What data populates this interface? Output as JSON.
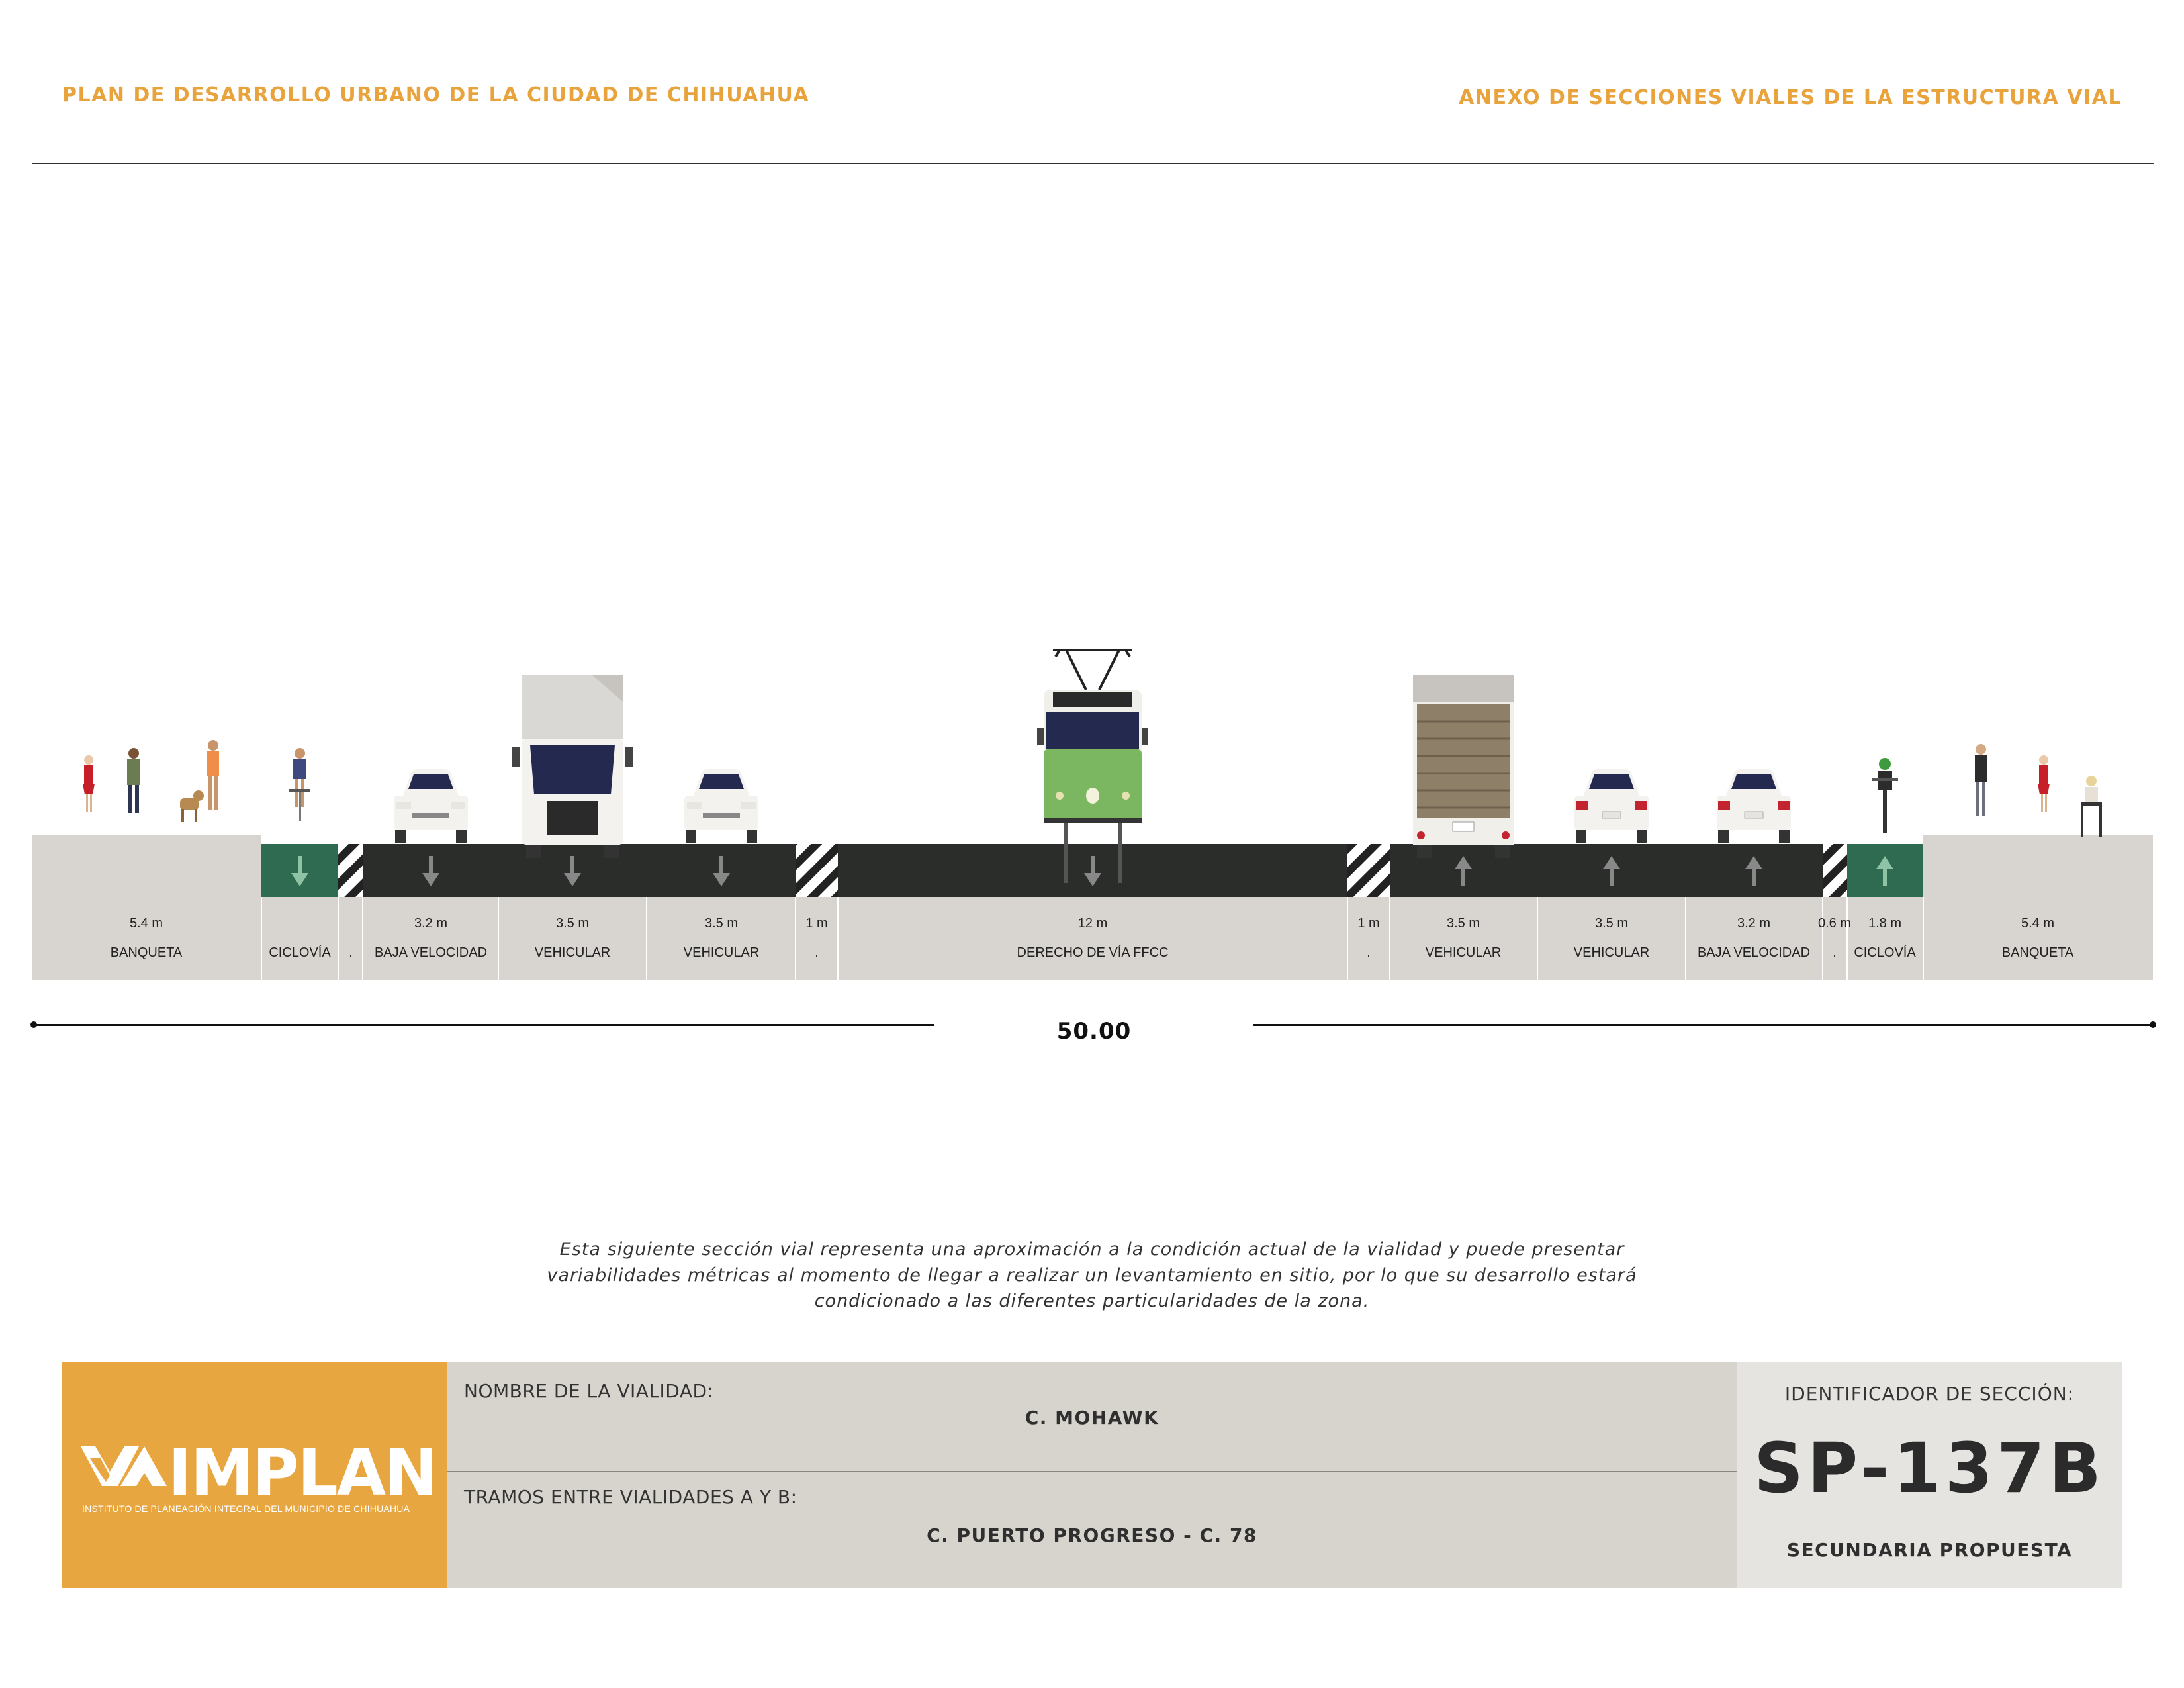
{
  "header": {
    "left_title": "PLAN DE DESARROLLO URBANO DE LA CIUDAD DE CHIHUAHUA",
    "right_title": "ANEXO DE SECCIONES VIALES DE LA ESTRUCTURA VIAL"
  },
  "colors": {
    "accent": "#E8A33D",
    "road": "#2B2D2B",
    "bikeway": "#2E6B50",
    "sidewalk": "#D8D4CF",
    "tram": "#7BB661"
  },
  "lanes": [
    {
      "width": "5.4 m",
      "label": "BANQUETA"
    },
    {
      "width": "",
      "label": "CICLOVÍA"
    },
    {
      "width": "",
      "label": "."
    },
    {
      "width": "3.2 m",
      "label": "BAJA VELOCIDAD"
    },
    {
      "width": "3.5 m",
      "label": "VEHICULAR"
    },
    {
      "width": "3.5 m",
      "label": "VEHICULAR"
    },
    {
      "width": "1 m",
      "label": "."
    },
    {
      "width": "12 m",
      "label": "DERECHO DE VÍA FFCC"
    },
    {
      "width": "1 m",
      "label": "."
    },
    {
      "width": "3.5 m",
      "label": "VEHICULAR"
    },
    {
      "width": "3.5 m",
      "label": "VEHICULAR"
    },
    {
      "width": "3.2 m",
      "label": "BAJA VELOCIDAD"
    },
    {
      "width": "0.6 m",
      "label": "."
    },
    {
      "width": "1.8 m",
      "label": "CICLOVÍA"
    },
    {
      "width": "5.4 m",
      "label": "BANQUETA"
    }
  ],
  "total_width": "50.00",
  "disclaimer": "Esta siguiente sección vial representa una aproximación a la condición actual de la vialidad y puede presentar variabilidades métricas al momento de llegar a realizar un levantamiento en sitio, por lo que su desarrollo estará condicionado a las diferentes particularidades de la zona.",
  "footer": {
    "logo_text": "IMPLAN",
    "logo_subtitle": "INSTITUTO DE PLANEACIÓN INTEGRAL DEL MUNICIPIO DE CHIHUAHUA",
    "road_name_label": "NOMBRE DE LA VIALIDAD:",
    "road_name": "C. MOHAWK",
    "segments_label": "TRAMOS ENTRE VIALIDADES A Y B:",
    "segments": "C. PUERTO PROGRESO - C. 78",
    "section_id_label": "IDENTIFICADOR DE SECCIÓN:",
    "section_id": "SP-137B",
    "classification": "SECUNDARIA PROPUESTA"
  }
}
